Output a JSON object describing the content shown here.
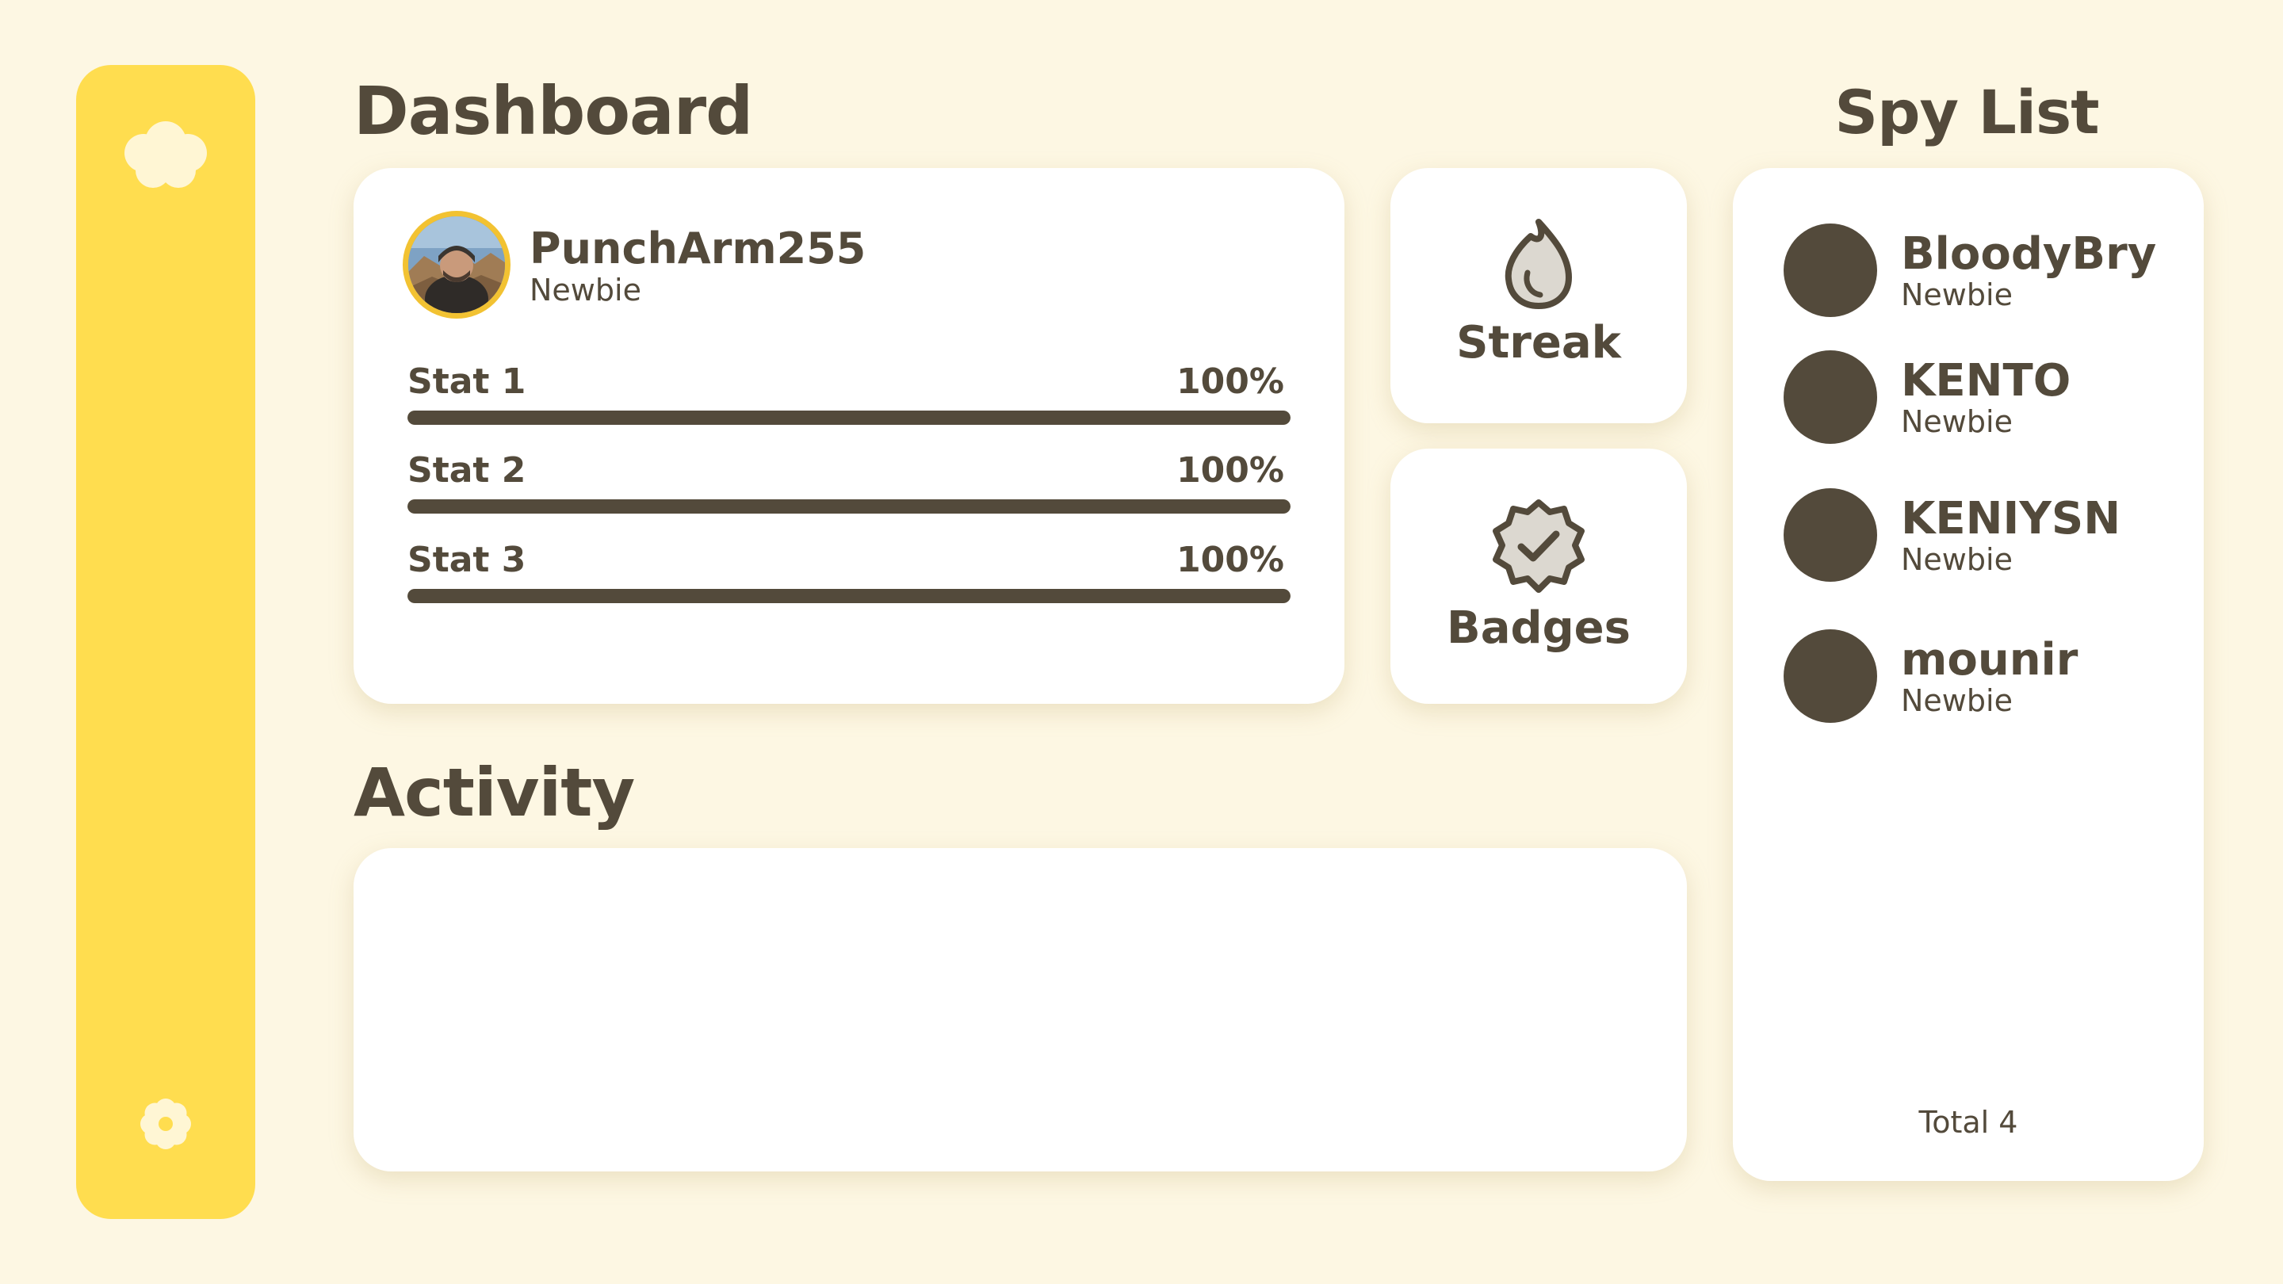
{
  "colors": {
    "background": "#fdf7e3",
    "sidebar": "#ffdd4f",
    "card": "#ffffff",
    "text": "#534a3b",
    "avatar_ring": "#f2c232"
  },
  "sidebar": {
    "top_icon": "cloud-icon",
    "bottom_icon": "flower-icon"
  },
  "dashboard": {
    "title": "Dashboard",
    "profile": {
      "username": "PunchArm255",
      "rank": "Newbie",
      "stats": [
        {
          "label": "Stat 1",
          "value_text": "100%",
          "progress": 1.0
        },
        {
          "label": "Stat 2",
          "value_text": "100%",
          "progress": 1.0
        },
        {
          "label": "Stat 3",
          "value_text": "100%",
          "progress": 1.0
        }
      ]
    },
    "tiles": [
      {
        "label": "Streak",
        "icon": "flame-icon"
      },
      {
        "label": "Badges",
        "icon": "badge-check-icon"
      }
    ]
  },
  "activity": {
    "title": "Activity"
  },
  "spy_list": {
    "title": "Spy List",
    "items": [
      {
        "name": "BloodyBry",
        "rank": "Newbie"
      },
      {
        "name": "KENTO",
        "rank": "Newbie"
      },
      {
        "name": "KENIYSN",
        "rank": "Newbie"
      },
      {
        "name": "mounir",
        "rank": "Newbie"
      }
    ],
    "total_text": "Total 4"
  }
}
